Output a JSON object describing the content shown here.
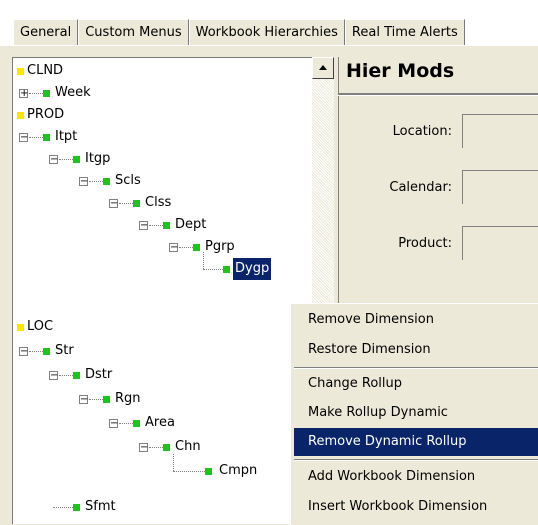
{
  "tabs": [
    "General",
    "Custom Menus",
    "Workbook Hierarchies",
    "Real Time Alerts"
  ],
  "tree": {
    "clnd": "CLND",
    "week": "Week",
    "prod": "PROD",
    "itpt": "Itpt",
    "itgp": "Itgp",
    "scls": "Scls",
    "clss": "Clss",
    "dept": "Dept",
    "pgrp": "Pgrp",
    "dygp": "Dygp",
    "loc": "LOC",
    "str": "Str",
    "dstr": "Dstr",
    "rgn": "Rgn",
    "area": "Area",
    "chn": "Chn",
    "cmpn": "Cmpn",
    "sfmt": "Sfmt"
  },
  "panel": {
    "title": "Hier Mods",
    "location_label": "Location:",
    "calendar_label": "Calendar:",
    "product_label": "Product:"
  },
  "context_menu": {
    "items": [
      "Remove Dimension",
      "Restore Dimension",
      "Change Rollup",
      "Make Rollup Dynamic",
      "Remove Dynamic Rollup",
      "Add Workbook Dimension",
      "Insert Workbook Dimension"
    ],
    "highlighted": "Remove Dynamic Rollup"
  },
  "colors": {
    "selection": "#0a246a",
    "node_root": "#ffe600",
    "node_level": "#22c122"
  }
}
